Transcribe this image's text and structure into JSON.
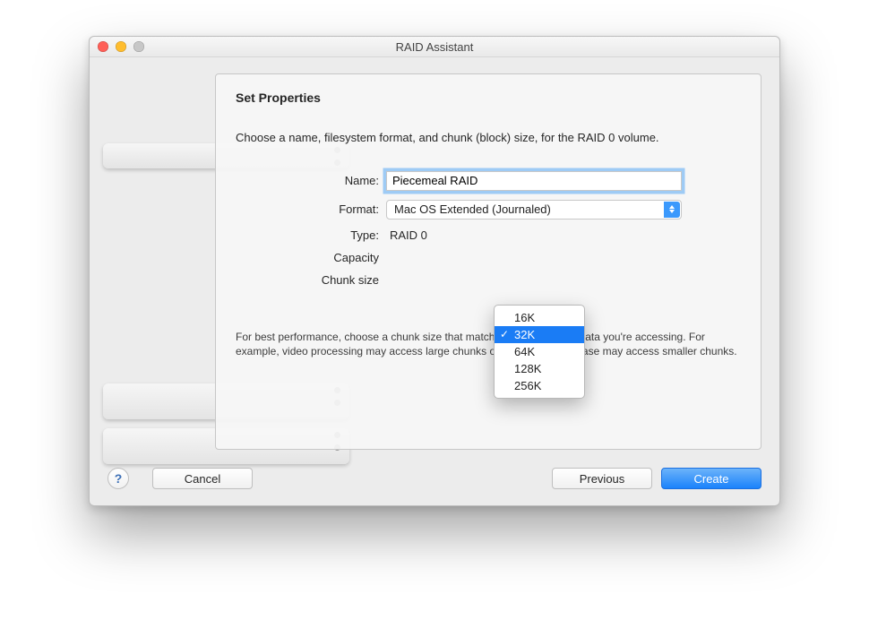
{
  "window": {
    "title": "RAID Assistant"
  },
  "panel": {
    "heading": "Set Properties",
    "intro": "Choose a name, filesystem format, and chunk (block) size, for the RAID 0 volume.",
    "hint": "For best performance, choose a chunk size that matches the size of the data you're accessing. For example, video processing may access large chunks of data, but a database may access smaller chunks."
  },
  "form": {
    "name_label": "Name:",
    "name_value": "Piecemeal RAID",
    "format_label": "Format:",
    "format_value": "Mac OS Extended (Journaled)",
    "type_label": "Type:",
    "type_value": "RAID 0",
    "capacity_label": "Capacity",
    "chunk_label": "Chunk size"
  },
  "chunk_menu": {
    "options": [
      "16K",
      "32K",
      "64K",
      "128K",
      "256K"
    ],
    "selected": "32K"
  },
  "footer": {
    "help": "?",
    "cancel": "Cancel",
    "previous": "Previous",
    "create": "Create"
  }
}
